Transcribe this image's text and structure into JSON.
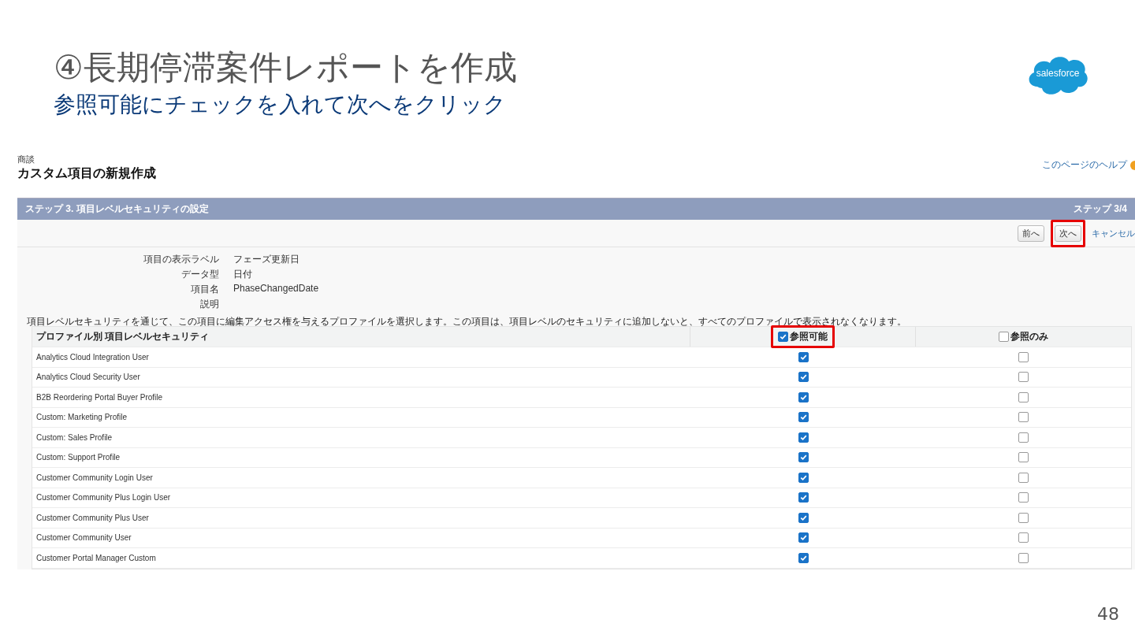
{
  "slide": {
    "title": "④長期停滞案件レポートを作成",
    "subtitle": "参照可能にチェックを入れて次へをクリック",
    "logo": "salesforce",
    "page_number": "48"
  },
  "screenshot": {
    "breadcrumb": "商談",
    "heading": "カスタム項目の新規作成",
    "help_link": "このページのヘルプ",
    "panel": {
      "title": "ステップ 3. 項目レベルセキュリティの設定",
      "step": "ステップ 3/4",
      "buttons": [
        {
          "label": "前へ",
          "highlighted": false
        },
        {
          "label": "次へ",
          "highlighted": true
        }
      ],
      "cancel_link": "キャンセル",
      "details": [
        {
          "label": "項目の表示ラベル",
          "value": "フェーズ更新日"
        },
        {
          "label": "データ型",
          "value": "日付"
        },
        {
          "label": "項目名",
          "value": "PhaseChangedDate"
        },
        {
          "label": "説明"
        }
      ],
      "instructions": "項目レベルセキュリティを通じて、この項目に編集アクセス権を与えるプロファイルを選択します。この項目は、項目レベルのセキュリティに追加しないと、すべてのプロファイルで表示されなくなります。",
      "table": {
        "columns": [
          {
            "label": "プロファイル別 項目レベルセキュリティ"
          },
          {
            "label": "参照可能",
            "checked": true,
            "highlighted": true
          },
          {
            "label": "参照のみ",
            "checked": false,
            "highlighted": false
          }
        ],
        "rows": [
          {
            "profile": "Analytics Cloud Integration User",
            "visible": true,
            "read_only": false
          },
          {
            "profile": "Analytics Cloud Security User",
            "visible": true,
            "read_only": false
          },
          {
            "profile": "B2B Reordering Portal Buyer Profile",
            "visible": true,
            "read_only": false
          },
          {
            "profile": "Custom: Marketing Profile",
            "visible": true,
            "read_only": false
          },
          {
            "profile": "Custom: Sales Profile",
            "visible": true,
            "read_only": false
          },
          {
            "profile": "Custom: Support Profile",
            "visible": true,
            "read_only": false
          },
          {
            "profile": "Customer Community Login User",
            "visible": true,
            "read_only": false
          },
          {
            "profile": "Customer Community Plus Login User",
            "visible": true,
            "read_only": false
          },
          {
            "profile": "Customer Community Plus User",
            "visible": true,
            "read_only": false
          },
          {
            "profile": "Customer Community User",
            "visible": true,
            "read_only": false
          },
          {
            "profile": "Customer Portal Manager Custom",
            "visible": true,
            "read_only": false
          }
        ]
      }
    }
  }
}
